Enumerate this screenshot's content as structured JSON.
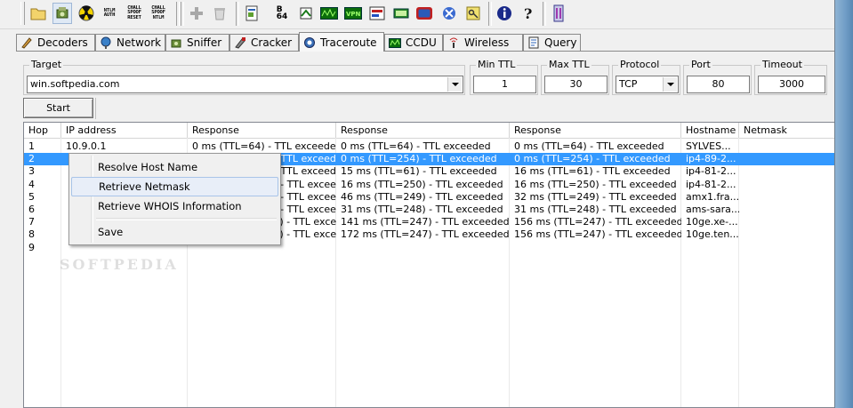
{
  "toolbar": {
    "buttons": [
      {
        "name": "open-folder-icon"
      },
      {
        "name": "sniffer-toggle-icon",
        "pressed": true
      },
      {
        "name": "apr-poison-icon"
      },
      {
        "name": "ntlm-auth-icon",
        "text": "NTLM\nAUTH"
      },
      {
        "name": "chall-spoof-reset-icon",
        "text": "CHALL\nSPOOF\nRESET"
      },
      {
        "name": "chall-spoof-ntlm-icon",
        "text": "CHALL\nSPOOF\nNTLM"
      },
      {
        "name": "add-icon"
      },
      {
        "name": "delete-icon"
      },
      {
        "name": "certificate-icon"
      },
      {
        "name": "base64-icon",
        "text": "B\n64"
      },
      {
        "name": "cisco-hash-icon"
      },
      {
        "name": "cdp-icon"
      },
      {
        "name": "vpn-icon"
      },
      {
        "name": "pwl-icon"
      },
      {
        "name": "dialup-icon"
      },
      {
        "name": "box-revealer-icon"
      },
      {
        "name": "tool-icon"
      },
      {
        "name": "keys-icon"
      },
      {
        "name": "info-icon"
      },
      {
        "name": "help-icon"
      },
      {
        "name": "exit-icon"
      }
    ]
  },
  "tabs": [
    {
      "label": "Decoders",
      "icon": "decoders-icon"
    },
    {
      "label": "Network",
      "icon": "network-icon"
    },
    {
      "label": "Sniffer",
      "icon": "sniffer-icon"
    },
    {
      "label": "Cracker",
      "icon": "cracker-icon"
    },
    {
      "label": "Traceroute",
      "icon": "traceroute-icon",
      "active": true
    },
    {
      "label": "CCDU",
      "icon": "ccdu-icon"
    },
    {
      "label": "Wireless",
      "icon": "wireless-icon"
    },
    {
      "label": "Query",
      "icon": "query-icon"
    }
  ],
  "form": {
    "target_label": "Target",
    "target_value": "win.softpedia.com",
    "min_ttl_label": "Min TTL",
    "min_ttl_value": "1",
    "max_ttl_label": "Max TTL",
    "max_ttl_value": "30",
    "protocol_label": "Protocol",
    "protocol_value": "TCP",
    "port_label": "Port",
    "port_value": "80",
    "timeout_label": "Timeout",
    "timeout_value": "3000",
    "start_label": "Start"
  },
  "table": {
    "columns": [
      "Hop",
      "IP address",
      "Response",
      "Response",
      "Response",
      "Hostname",
      "Netmask"
    ],
    "rows": [
      {
        "hop": "1",
        "ip": "10.9.0.1",
        "r1": "0 ms (TTL=64) - TTL exceeded",
        "r2": "0 ms (TTL=64) - TTL exceeded",
        "r3": "0 ms (TTL=64) - TTL exceeded",
        "host": "SYLVES...",
        "mask": ""
      },
      {
        "hop": "2",
        "ip": "",
        "r1": "0 ms (TTL=254) - TTL exceeded",
        "r2": "0 ms (TTL=254) - TTL exceeded",
        "r3": "0 ms (TTL=254) - TTL exceeded",
        "host": "ip4-89-2...",
        "mask": "",
        "selected": true
      },
      {
        "hop": "3",
        "ip": "",
        "r1": "15 ms (TTL=61) - TTL exceeded",
        "r2": "15 ms (TTL=61) - TTL exceeded",
        "r3": "16 ms (TTL=61) - TTL exceeded",
        "host": "ip4-81-2...",
        "mask": ""
      },
      {
        "hop": "4",
        "ip": "",
        "r1": "16 ms (TTL=250) - TTL exceeded",
        "r2": "16 ms (TTL=250) - TTL exceeded",
        "r3": "16 ms (TTL=250) - TTL exceeded",
        "host": "ip4-81-2...",
        "mask": ""
      },
      {
        "hop": "5",
        "ip": "",
        "r1": "46 ms (TTL=249) - TTL exceeded",
        "r2": "46 ms (TTL=249) - TTL exceeded",
        "r3": "32 ms (TTL=249) - TTL exceeded",
        "host": "amx1.fra...",
        "mask": ""
      },
      {
        "hop": "6",
        "ip": "",
        "r1": "31 ms (TTL=248) - TTL exceeded",
        "r2": "31 ms (TTL=248) - TTL exceeded",
        "r3": "31 ms (TTL=248) - TTL exceeded",
        "host": "ams-sara...",
        "mask": ""
      },
      {
        "hop": "7",
        "ip": "",
        "r1": "141 ms (TTL=247) - TTL exceeded",
        "r2": "141 ms (TTL=247) - TTL exceeded",
        "r3": "156 ms (TTL=247) - TTL exceeded",
        "host": "10ge.xe-...",
        "mask": ""
      },
      {
        "hop": "8",
        "ip": "",
        "r1": "172 ms (TTL=247) - TTL exceeded",
        "r2": "172 ms (TTL=247) - TTL exceeded",
        "r3": "156 ms (TTL=247) - TTL exceeded",
        "host": "10ge.ten...",
        "mask": ""
      },
      {
        "hop": "9",
        "ip": "",
        "r1": "",
        "r2": "",
        "r3": "",
        "host": "",
        "mask": ""
      }
    ]
  },
  "context_menu": {
    "items": [
      {
        "label": "Resolve Host Name"
      },
      {
        "label": "Retrieve Netmask",
        "hot": true
      },
      {
        "label": "Retrieve WHOIS Information"
      },
      {
        "label": "Save"
      }
    ]
  },
  "watermark": "SOFTPEDIA"
}
